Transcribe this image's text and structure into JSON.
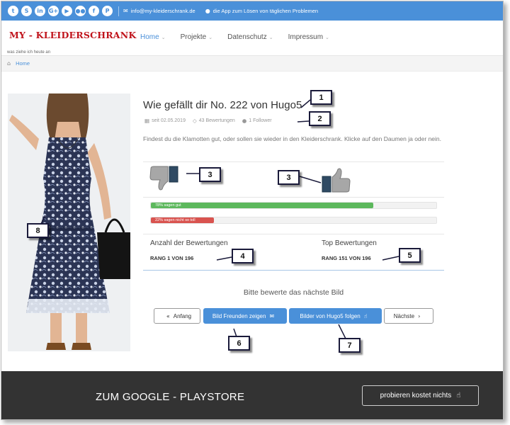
{
  "topbar": {
    "social_icons": [
      {
        "name": "twitter-icon",
        "glyph": "t"
      },
      {
        "name": "skype-icon",
        "glyph": "S"
      },
      {
        "name": "linkedin-icon",
        "glyph": "in"
      },
      {
        "name": "googleplus-icon",
        "glyph": "G+"
      },
      {
        "name": "youtube-icon",
        "glyph": "▶"
      },
      {
        "name": "flickr-icon",
        "glyph": "●●"
      },
      {
        "name": "facebook-icon",
        "glyph": "f"
      },
      {
        "name": "pinterest-icon",
        "glyph": "P"
      }
    ],
    "email": "info@my-kleiderschrank.de",
    "app_text": "die App zum Lösen von täglichen Problemen"
  },
  "header": {
    "logo": "MY - KLEIDERSCHRANK",
    "tagline": "was ziehe ich heute an",
    "nav": [
      "Home",
      "Projekte",
      "Datenschutz",
      "Impressum"
    ]
  },
  "breadcrumb": {
    "home": "Home"
  },
  "main": {
    "title": "Wie gefällt dir No. 222 von Hugo5",
    "date": "seit 02.05.2019",
    "ratings_count": "43 Bewertungen",
    "followers": "1 Follower",
    "description": "Findest du die Klamotten gut, oder sollen sie wieder in den Kleiderschrank. Klicke auf den Daumen ja oder nein.",
    "good": {
      "label": "78% sagen gut",
      "percent": 78
    },
    "bad": {
      "label": "22% sagen nicht so toll",
      "percent": 22
    },
    "stats": {
      "count_title": "Anzahl der Bewertungen",
      "count_value": "RANG 1 VON 196",
      "top_title": "Top Bewertungen",
      "top_value": "RANG 151 VON 196"
    },
    "next_prompt": "Bitte bewerte das nächste Bild",
    "buttons": {
      "start": "Anfang",
      "share": "Bild Freunden zeigen",
      "follow": "Bilder von Hugo5 folgen",
      "next": "Nächste"
    }
  },
  "footer": {
    "title": "ZUM GOOGLE - PLAYSTORE",
    "button": "probieren kostet nichts"
  },
  "callouts": [
    "1",
    "2",
    "3",
    "3",
    "4",
    "5",
    "6",
    "7",
    "8"
  ],
  "colors": {
    "accent": "#4a90d9",
    "logo": "#c0131b",
    "good": "#5cb85c",
    "bad": "#d9534f",
    "footer": "#333333"
  }
}
